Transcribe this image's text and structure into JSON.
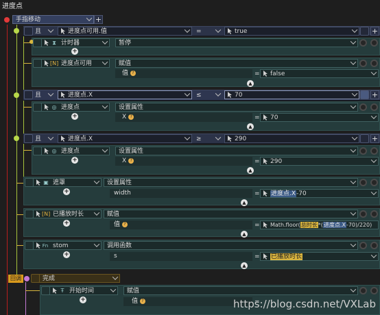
{
  "panel_title": "进度点",
  "event": {
    "label": "手指移动",
    "add": "+"
  },
  "cond1": {
    "logic": "且",
    "left": "进度点可用.值",
    "op": "=",
    "right": "true"
  },
  "b1": {
    "timer": {
      "target": "计时器",
      "action": "暂停"
    },
    "assign": {
      "target": "进度点可用",
      "action": "赋值",
      "field": "值",
      "op": "=",
      "value": "false"
    }
  },
  "cond2": {
    "logic": "且",
    "left": "进度点.X",
    "op": "≤",
    "right": "70"
  },
  "b2": {
    "target": "进度点",
    "action": "设置属性",
    "field": "X",
    "op": "=",
    "value": "70"
  },
  "cond3": {
    "logic": "且",
    "left": "进度点.X",
    "op": "≥",
    "right": "290"
  },
  "b3": {
    "target": "进度点",
    "action": "设置属性",
    "field": "X",
    "op": "=",
    "value": "290"
  },
  "a4": {
    "target": "遮罩",
    "action": "设置属性",
    "field": "width",
    "op": "=",
    "value_tag": "进度点.X",
    "value_rest": "-70"
  },
  "a5": {
    "target": "已播放时长",
    "action": "赋值",
    "field": "值",
    "op": "=",
    "v1": "Math.floor(",
    "v2": "总时长",
    "v3": "*(",
    "v4": "进度点.X",
    "v5": "-70)/220)"
  },
  "a6": {
    "target": "stom",
    "action": "调用函数",
    "field": "s",
    "op": "=",
    "value": "已播放时长"
  },
  "callback": {
    "tag": "回调",
    "label": "完成"
  },
  "a7": {
    "target": "开始时间",
    "action": "赋值",
    "field": "值",
    "op": "="
  },
  "icons": {
    "variable": "[N]",
    "function": "Fn",
    "plus": "+"
  },
  "watermark": "https://blog.csdn.net/VXLab",
  "colors": {
    "event_bar": "#343f5e",
    "cond_bar": "#2c3348",
    "action_panel": "#253c3c",
    "green_line": "#a8c43c",
    "yellow_line": "#d8b63e",
    "callback": "#d99a1c"
  }
}
